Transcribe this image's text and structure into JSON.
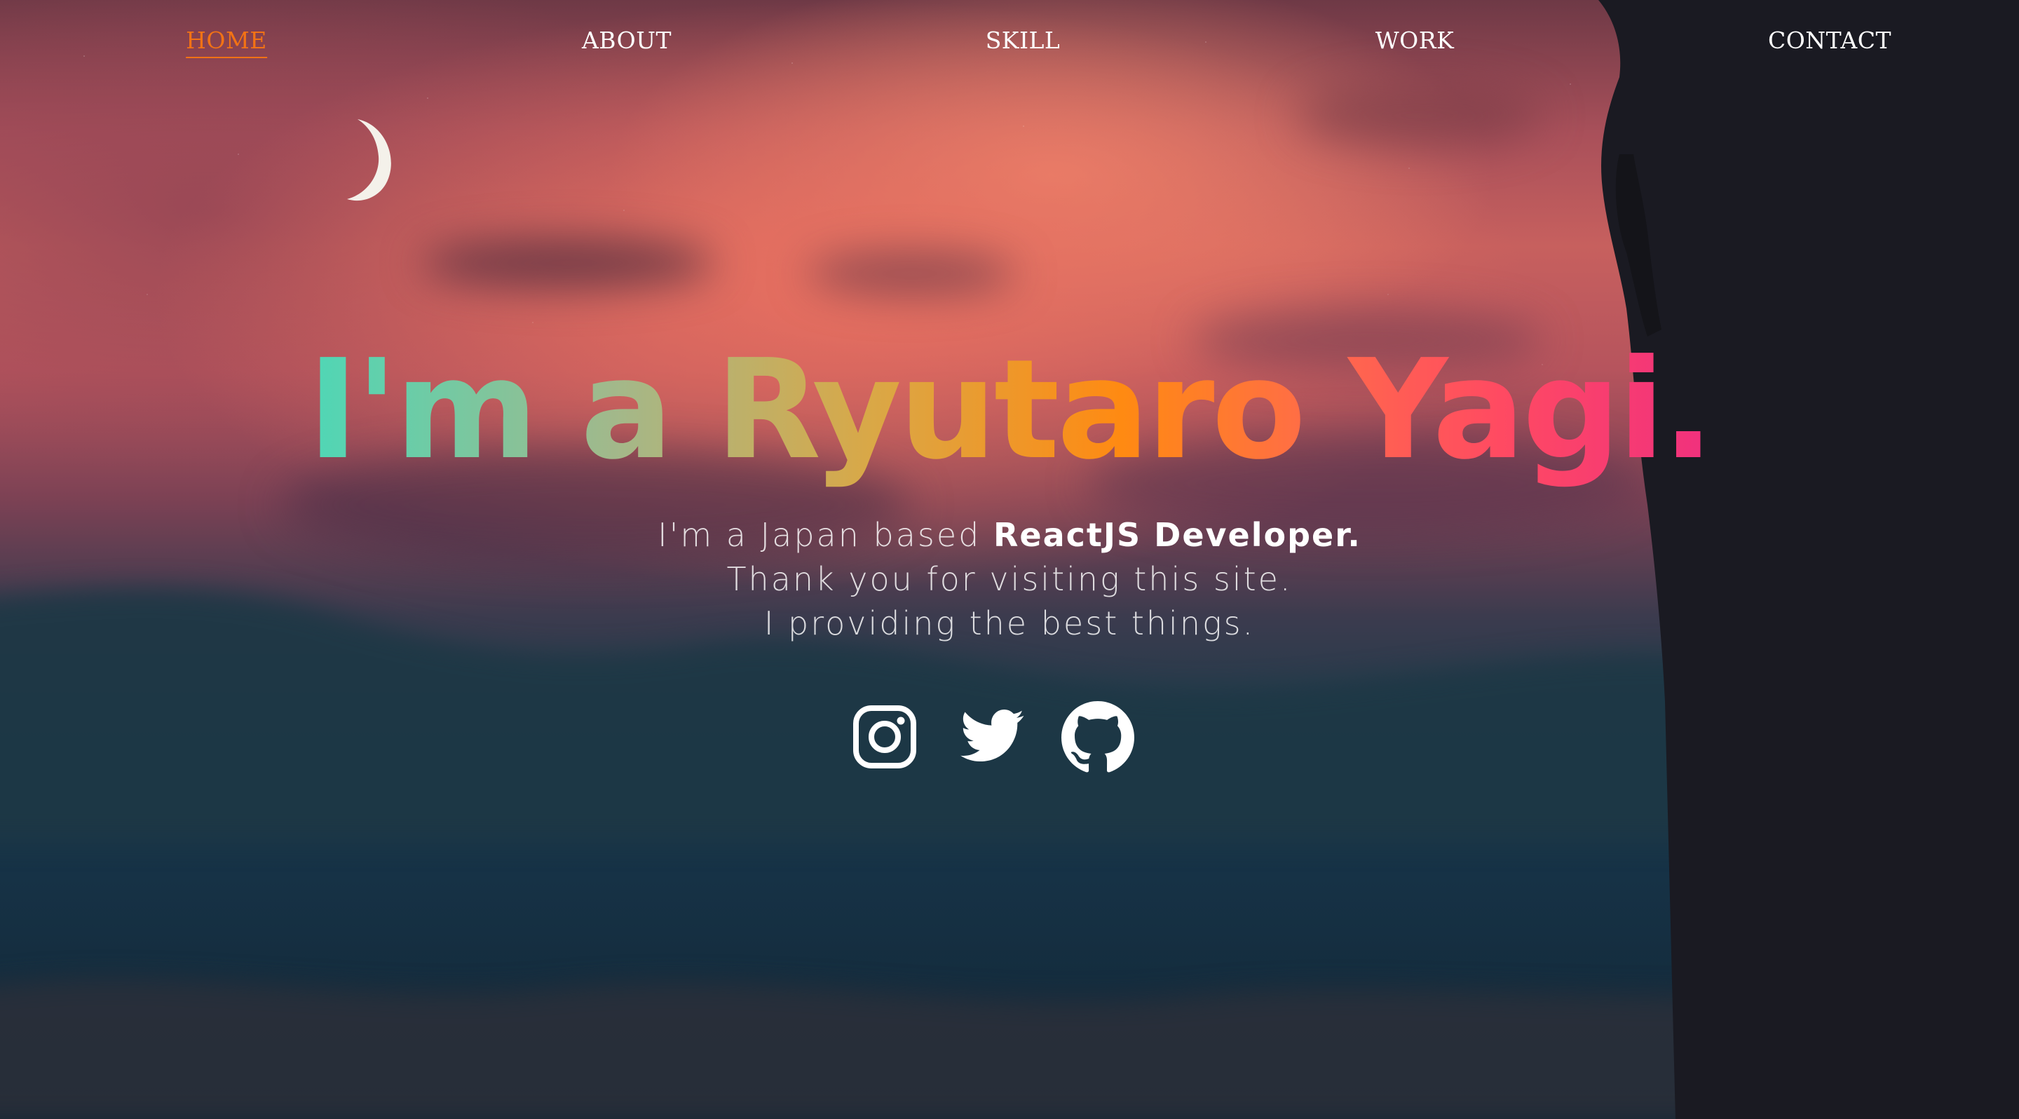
{
  "nav": {
    "items": [
      {
        "label": "HOME",
        "active": true
      },
      {
        "label": "ABOUT",
        "active": false
      },
      {
        "label": "SKILL",
        "active": false
      },
      {
        "label": "WORK",
        "active": false
      },
      {
        "label": "CONTACT",
        "active": false
      }
    ]
  },
  "hero": {
    "title": "I'm a Ryutaro Yagi.",
    "subtitle": {
      "line1_prefix": "I'm a Japan based ",
      "line1_strong": "ReactJS Developer.",
      "line2": "Thank you for visiting this site.",
      "line3": "I providing the best things."
    }
  },
  "socials": [
    {
      "icon": "instagram-icon"
    },
    {
      "icon": "twitter-icon"
    },
    {
      "icon": "github-icon"
    }
  ],
  "colors": {
    "nav_active": "#f27215",
    "nav_text": "#ffffff",
    "gradient_start": "#4ed7b6",
    "gradient_mid": "#ff8a12",
    "gradient_end": "#f0307e"
  }
}
